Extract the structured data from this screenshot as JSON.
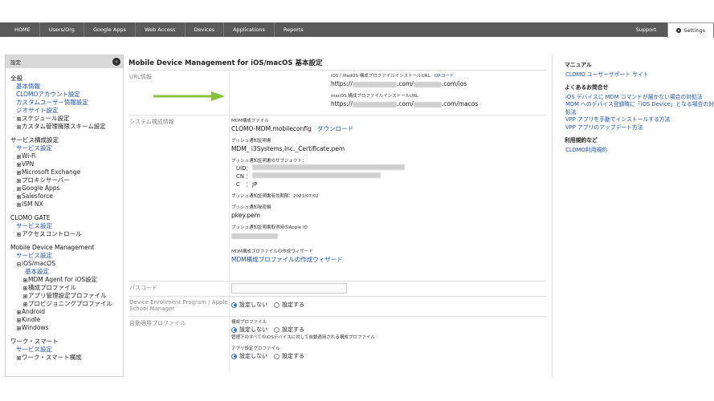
{
  "nav": {
    "items": [
      "HOME",
      "Users/Org",
      "Google Apps",
      "Web Access",
      "Devices",
      "Applications",
      "Reports"
    ],
    "support": "Support",
    "settings": "Settings"
  },
  "sidebar": {
    "header": "設定",
    "collapse_icon": "‹",
    "groups": [
      {
        "title": "全般",
        "items": [
          {
            "label": "基本情報",
            "type": "link"
          },
          {
            "label": "CLOMOアカウント設定",
            "type": "link"
          },
          {
            "label": "カスタムユーザー情報設定",
            "type": "link"
          },
          {
            "label": "ジオサイト設定",
            "type": "link"
          },
          {
            "label": "スケジュール設定",
            "type": "plus"
          },
          {
            "label": "カスタム管理権限スキーム設定",
            "type": "plus"
          }
        ]
      },
      {
        "title": "サービス構成設定",
        "items": [
          {
            "label": "サービス設定",
            "type": "link"
          },
          {
            "label": "Wi-Fi",
            "type": "plus"
          },
          {
            "label": "VPN",
            "type": "plus"
          },
          {
            "label": "Microsoft Exchange",
            "type": "plus"
          },
          {
            "label": "プロキシサーバー",
            "type": "plus"
          },
          {
            "label": "Google Apps",
            "type": "plus"
          },
          {
            "label": "Salesforce",
            "type": "plus"
          },
          {
            "label": "ISM NX",
            "type": "plus"
          }
        ]
      },
      {
        "title": "CLOMO GATE",
        "items": [
          {
            "label": "サービス設定",
            "type": "link"
          },
          {
            "label": "アクセスコントロール",
            "type": "plus"
          }
        ]
      },
      {
        "title": "Mobile Device Management",
        "items": [
          {
            "label": "サービス設定",
            "type": "link"
          },
          {
            "label": "iOS/macOS",
            "type": "minus"
          },
          {
            "label": "基本設定",
            "type": "current"
          },
          {
            "label": "MDM Agent for iOS設定",
            "type": "plus2"
          },
          {
            "label": "構成プロファイル",
            "type": "plus2"
          },
          {
            "label": "アプリ管理設定プロファイル",
            "type": "plus2"
          },
          {
            "label": "プロビジョニングプロファイル",
            "type": "plus2"
          },
          {
            "label": "Android",
            "type": "plus"
          },
          {
            "label": "Kindle",
            "type": "plus"
          },
          {
            "label": "Windows",
            "type": "plus"
          }
        ]
      },
      {
        "title": "ワーク・スマート",
        "items": [
          {
            "label": "サービス設定",
            "type": "link"
          },
          {
            "label": "ワーク・スマート構成",
            "type": "plus"
          }
        ]
      }
    ]
  },
  "main": {
    "title": "Mobile Device Management for iOS/macOS 基本設定",
    "url": {
      "label": "URL情報",
      "ios_caption": "iOS / iPadOS 構成プロファイルインストールURL",
      "qr": "QRコード",
      "ios_prefix": "https://",
      "ios_mid": ".com/",
      "ios_suffix": ".com/ios",
      "mac_caption": "macOS 構成プロファイルインストールURL",
      "mac_prefix": "https://",
      "mac_mid": ".com/",
      "mac_suffix": ".com/macos"
    },
    "system": {
      "label": "システム構成情報",
      "mdm_cfg_caption": "MDM構成ファイル",
      "mdm_cfg_file": "CLOMO-MDM.mobileconfig",
      "download": "ダウンロード",
      "push_cert_caption": "プッシュ通知証明書",
      "push_cert_file": "MDM_ i3Systems,Inc._Certificate.pem",
      "subject_caption": "プッシュ通知証明書のサブジェクト：",
      "uid_key": "UID",
      "cn_key": "CN",
      "c_key": "C",
      "c_val": "JP",
      "colon": "：",
      "expiry": "プッシュ通知証明書有効期限：2021/07/02",
      "key_caption": "プッシュ通知秘密鍵",
      "key_file": "pkey.pem",
      "appleid_caption": "プッシュ通知証明書取得時のApple ID",
      "wizard_caption": "MDM構成プロファイルの作成ウィザード",
      "wizard_link": "MDM構成プロファイルの作成ウィザード"
    },
    "passcode": {
      "label": "パスコード"
    },
    "dep": {
      "label": "Device Enrollment Program / Apple School Manager",
      "off": "設定しない",
      "on": "設定する"
    },
    "auto": {
      "label": "自動適用プロファイル",
      "cfg_caption": "構成プロファイル",
      "off": "設定しない",
      "on": "設定する",
      "note": "管理下のすべてのiOSデバイスに対して自動適用される構成プロファイル",
      "app_caption": "アプリ設定プロファイル"
    }
  },
  "right": {
    "manual_title": "マニュアル",
    "manual_link": "CLOMO ユーザーサポート サイト",
    "faq_title": "よくあるお問合せ",
    "faq": [
      "iOS デバイスに MDM コマンドが届かない場合の対処法",
      "MDM へのデバイス登録時に「iOS Device」となる場合の対処法",
      "VPP アプリを手動でインストールする方法",
      "VPP アプリのアップデート方法"
    ],
    "terms_title": "利用規約など",
    "terms_link": "CLOMO利用規約"
  },
  "colors": {
    "nav_bg": "#5a5a5a",
    "link": "#1a4fb4",
    "arrow": "#86c23e"
  },
  "icons": {
    "settings": "gear-icon",
    "collapse": "chevron-left-icon",
    "arrow": "green-arrow-icon"
  }
}
